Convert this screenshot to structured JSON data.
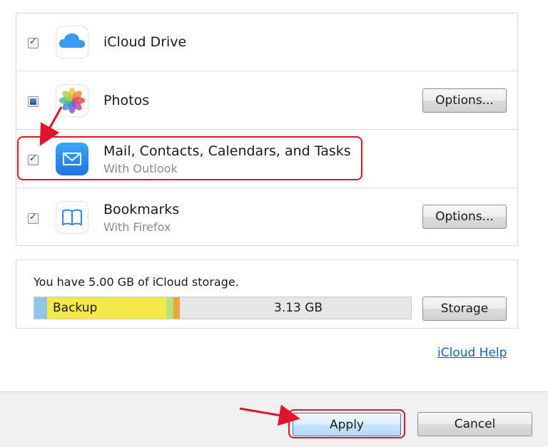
{
  "services": [
    {
      "title": "iCloud Drive",
      "subtitle": "",
      "state": "checked",
      "icon": "icloud-drive-icon"
    },
    {
      "title": "Photos",
      "subtitle": "",
      "state": "indeterminate",
      "icon": "photos-icon",
      "button": "Options..."
    },
    {
      "title": "Mail, Contacts, Calendars, and Tasks",
      "subtitle": "With Outlook",
      "state": "checked",
      "icon": "mail-icon"
    },
    {
      "title": "Bookmarks",
      "subtitle": "With Firefox",
      "state": "checked",
      "icon": "bookmarks-icon",
      "button": "Options..."
    }
  ],
  "storage": {
    "summary": "You have 5.00 GB of iCloud storage.",
    "backup_label": "Backup",
    "free_label": "3.13 GB",
    "button": "Storage",
    "colors": {
      "system": "#8ec5ea",
      "backup": "#f7e84a",
      "other1": "#b9e07a",
      "other2": "#f2a23a"
    }
  },
  "help_link": "iCloud Help",
  "footer": {
    "apply": "Apply",
    "cancel": "Cancel"
  },
  "accent": "#e0142a"
}
